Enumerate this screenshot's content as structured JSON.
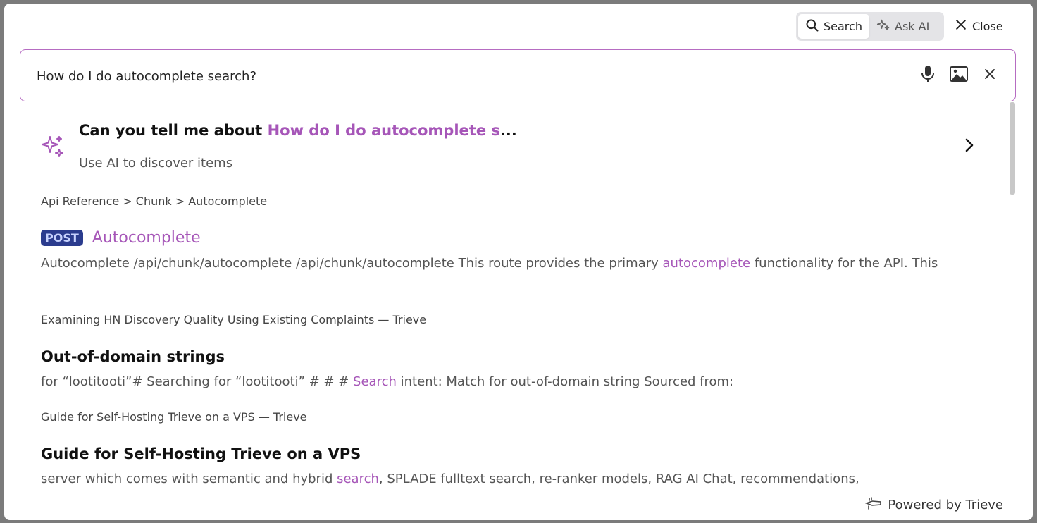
{
  "toolbar": {
    "search_label": "Search",
    "ask_ai_label": "Ask AI",
    "close_label": "Close"
  },
  "search": {
    "value": "How do I do autocomplete search?"
  },
  "ask_ai": {
    "prefix": "Can you tell me about ",
    "query_truncated": "How do I do autocomplete s",
    "ellipsis": "...",
    "subtitle": "Use AI to discover items"
  },
  "results": [
    {
      "breadcrumb": "Api Reference > Chunk > Autocomplete",
      "badge": "POST",
      "title": "Autocomplete",
      "body_before": "Autocomplete /api/chunk/autocomplete /api/chunk/autocomplete This route provides the primary ",
      "body_highlight": "autocomplete",
      "body_after": " functionality for the API. This"
    },
    {
      "breadcrumb": "Examining HN Discovery Quality Using Existing Complaints — Trieve",
      "title": "Out-of-domain strings",
      "body_before": "for “lootitooti”# Searching for “lootitooti” # # # ",
      "body_highlight": "Search",
      "body_after": " intent: Match for out-of-domain string Sourced from:"
    },
    {
      "breadcrumb": "Guide for Self-Hosting Trieve on a VPS — Trieve",
      "title": "Guide for Self-Hosting Trieve on a VPS",
      "body_before": "server which comes with semantic and hybrid ",
      "body_highlight": "search",
      "body_after": ", SPLADE fulltext search, re-ranker models, RAG AI Chat, recommendations,"
    }
  ],
  "footer": {
    "powered_by": "Powered by Trieve"
  },
  "colors": {
    "accent": "#a656b8",
    "badge_bg": "#2b3c8e",
    "toggle_bg": "#e4e4e7"
  }
}
